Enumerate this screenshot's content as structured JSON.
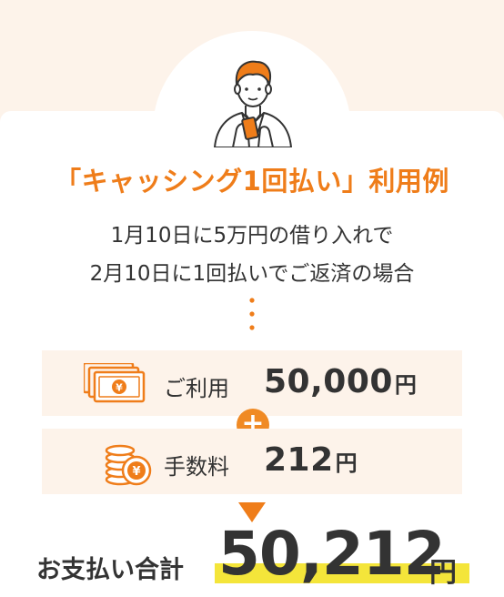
{
  "title": "「キャッシング1回払い」利用例",
  "description": {
    "line1": "1月10日に5万円の借り入れで",
    "line2": "2月10日に1回払いでご返済の場合"
  },
  "usage": {
    "label": "ご利用",
    "value": "50,000",
    "unit": "円",
    "icon": "banknotes-yen-icon"
  },
  "fee": {
    "label": "手数料",
    "value": "212",
    "unit": "円",
    "icon": "coins-yen-icon"
  },
  "plus_symbol": "+",
  "total": {
    "label": "お支払い合計",
    "value": "50,212",
    "unit": "円"
  },
  "colors": {
    "accent": "#ef7d1a",
    "background": "#fdf3ea",
    "highlight": "#f4e53a"
  }
}
